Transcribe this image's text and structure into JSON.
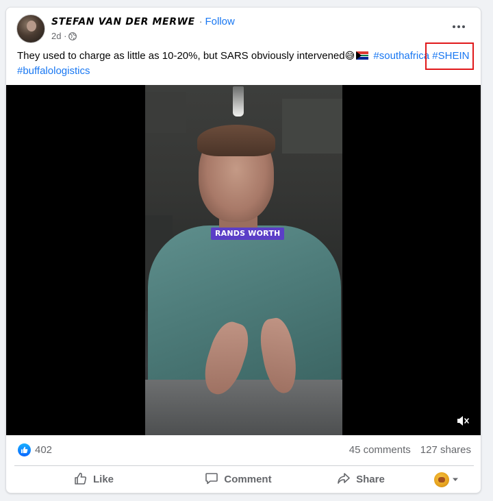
{
  "post": {
    "author": "STEFAN VAN DER MERWE",
    "separator": "·",
    "follow_label": "Follow",
    "time": "2d",
    "caption_text": "They used to charge as little as 10-20%, but SARS obviously intervened",
    "emoji": "😅",
    "hashtags": [
      "#southafrica",
      "#SHEIN",
      "#buffalologistics"
    ],
    "video_caption": "RANDS WORTH"
  },
  "stats": {
    "likes": "402",
    "comments": "45 comments",
    "shares": "127 shares"
  },
  "actions": {
    "like_label": "Like",
    "comment_label": "Comment",
    "share_label": "Share"
  },
  "icons": {
    "privacy": "globe-icon",
    "more": "more-options-icon",
    "reaction": "like-reaction-icon",
    "mute": "muted-speaker-icon",
    "audience_menu": "chevron-down-icon"
  },
  "colors": {
    "link": "#1877f2",
    "highlight": "#e0181a",
    "caption_bg": "#5b3ec7"
  }
}
